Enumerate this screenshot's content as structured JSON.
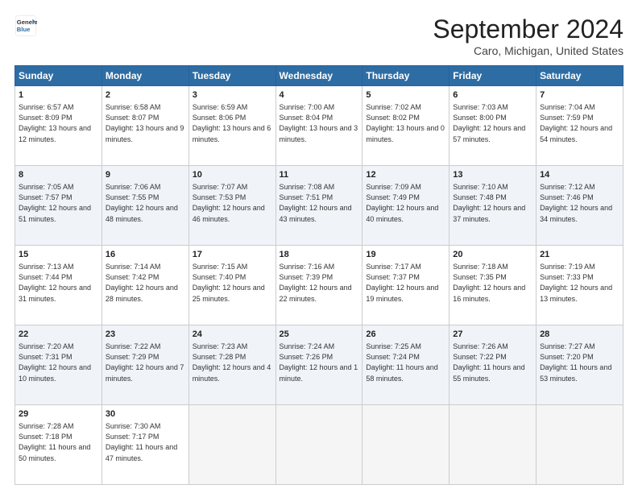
{
  "logo": {
    "line1": "General",
    "line2": "Blue"
  },
  "title": "September 2024",
  "subtitle": "Caro, Michigan, United States",
  "weekdays": [
    "Sunday",
    "Monday",
    "Tuesday",
    "Wednesday",
    "Thursday",
    "Friday",
    "Saturday"
  ],
  "weeks": [
    [
      {
        "day": "1",
        "sunrise": "Sunrise: 6:57 AM",
        "sunset": "Sunset: 8:09 PM",
        "daylight": "Daylight: 13 hours and 12 minutes."
      },
      {
        "day": "2",
        "sunrise": "Sunrise: 6:58 AM",
        "sunset": "Sunset: 8:07 PM",
        "daylight": "Daylight: 13 hours and 9 minutes."
      },
      {
        "day": "3",
        "sunrise": "Sunrise: 6:59 AM",
        "sunset": "Sunset: 8:06 PM",
        "daylight": "Daylight: 13 hours and 6 minutes."
      },
      {
        "day": "4",
        "sunrise": "Sunrise: 7:00 AM",
        "sunset": "Sunset: 8:04 PM",
        "daylight": "Daylight: 13 hours and 3 minutes."
      },
      {
        "day": "5",
        "sunrise": "Sunrise: 7:02 AM",
        "sunset": "Sunset: 8:02 PM",
        "daylight": "Daylight: 13 hours and 0 minutes."
      },
      {
        "day": "6",
        "sunrise": "Sunrise: 7:03 AM",
        "sunset": "Sunset: 8:00 PM",
        "daylight": "Daylight: 12 hours and 57 minutes."
      },
      {
        "day": "7",
        "sunrise": "Sunrise: 7:04 AM",
        "sunset": "Sunset: 7:59 PM",
        "daylight": "Daylight: 12 hours and 54 minutes."
      }
    ],
    [
      {
        "day": "8",
        "sunrise": "Sunrise: 7:05 AM",
        "sunset": "Sunset: 7:57 PM",
        "daylight": "Daylight: 12 hours and 51 minutes."
      },
      {
        "day": "9",
        "sunrise": "Sunrise: 7:06 AM",
        "sunset": "Sunset: 7:55 PM",
        "daylight": "Daylight: 12 hours and 48 minutes."
      },
      {
        "day": "10",
        "sunrise": "Sunrise: 7:07 AM",
        "sunset": "Sunset: 7:53 PM",
        "daylight": "Daylight: 12 hours and 46 minutes."
      },
      {
        "day": "11",
        "sunrise": "Sunrise: 7:08 AM",
        "sunset": "Sunset: 7:51 PM",
        "daylight": "Daylight: 12 hours and 43 minutes."
      },
      {
        "day": "12",
        "sunrise": "Sunrise: 7:09 AM",
        "sunset": "Sunset: 7:49 PM",
        "daylight": "Daylight: 12 hours and 40 minutes."
      },
      {
        "day": "13",
        "sunrise": "Sunrise: 7:10 AM",
        "sunset": "Sunset: 7:48 PM",
        "daylight": "Daylight: 12 hours and 37 minutes."
      },
      {
        "day": "14",
        "sunrise": "Sunrise: 7:12 AM",
        "sunset": "Sunset: 7:46 PM",
        "daylight": "Daylight: 12 hours and 34 minutes."
      }
    ],
    [
      {
        "day": "15",
        "sunrise": "Sunrise: 7:13 AM",
        "sunset": "Sunset: 7:44 PM",
        "daylight": "Daylight: 12 hours and 31 minutes."
      },
      {
        "day": "16",
        "sunrise": "Sunrise: 7:14 AM",
        "sunset": "Sunset: 7:42 PM",
        "daylight": "Daylight: 12 hours and 28 minutes."
      },
      {
        "day": "17",
        "sunrise": "Sunrise: 7:15 AM",
        "sunset": "Sunset: 7:40 PM",
        "daylight": "Daylight: 12 hours and 25 minutes."
      },
      {
        "day": "18",
        "sunrise": "Sunrise: 7:16 AM",
        "sunset": "Sunset: 7:39 PM",
        "daylight": "Daylight: 12 hours and 22 minutes."
      },
      {
        "day": "19",
        "sunrise": "Sunrise: 7:17 AM",
        "sunset": "Sunset: 7:37 PM",
        "daylight": "Daylight: 12 hours and 19 minutes."
      },
      {
        "day": "20",
        "sunrise": "Sunrise: 7:18 AM",
        "sunset": "Sunset: 7:35 PM",
        "daylight": "Daylight: 12 hours and 16 minutes."
      },
      {
        "day": "21",
        "sunrise": "Sunrise: 7:19 AM",
        "sunset": "Sunset: 7:33 PM",
        "daylight": "Daylight: 12 hours and 13 minutes."
      }
    ],
    [
      {
        "day": "22",
        "sunrise": "Sunrise: 7:20 AM",
        "sunset": "Sunset: 7:31 PM",
        "daylight": "Daylight: 12 hours and 10 minutes."
      },
      {
        "day": "23",
        "sunrise": "Sunrise: 7:22 AM",
        "sunset": "Sunset: 7:29 PM",
        "daylight": "Daylight: 12 hours and 7 minutes."
      },
      {
        "day": "24",
        "sunrise": "Sunrise: 7:23 AM",
        "sunset": "Sunset: 7:28 PM",
        "daylight": "Daylight: 12 hours and 4 minutes."
      },
      {
        "day": "25",
        "sunrise": "Sunrise: 7:24 AM",
        "sunset": "Sunset: 7:26 PM",
        "daylight": "Daylight: 12 hours and 1 minute."
      },
      {
        "day": "26",
        "sunrise": "Sunrise: 7:25 AM",
        "sunset": "Sunset: 7:24 PM",
        "daylight": "Daylight: 11 hours and 58 minutes."
      },
      {
        "day": "27",
        "sunrise": "Sunrise: 7:26 AM",
        "sunset": "Sunset: 7:22 PM",
        "daylight": "Daylight: 11 hours and 55 minutes."
      },
      {
        "day": "28",
        "sunrise": "Sunrise: 7:27 AM",
        "sunset": "Sunset: 7:20 PM",
        "daylight": "Daylight: 11 hours and 53 minutes."
      }
    ],
    [
      {
        "day": "29",
        "sunrise": "Sunrise: 7:28 AM",
        "sunset": "Sunset: 7:18 PM",
        "daylight": "Daylight: 11 hours and 50 minutes."
      },
      {
        "day": "30",
        "sunrise": "Sunrise: 7:30 AM",
        "sunset": "Sunset: 7:17 PM",
        "daylight": "Daylight: 11 hours and 47 minutes."
      },
      null,
      null,
      null,
      null,
      null
    ]
  ]
}
